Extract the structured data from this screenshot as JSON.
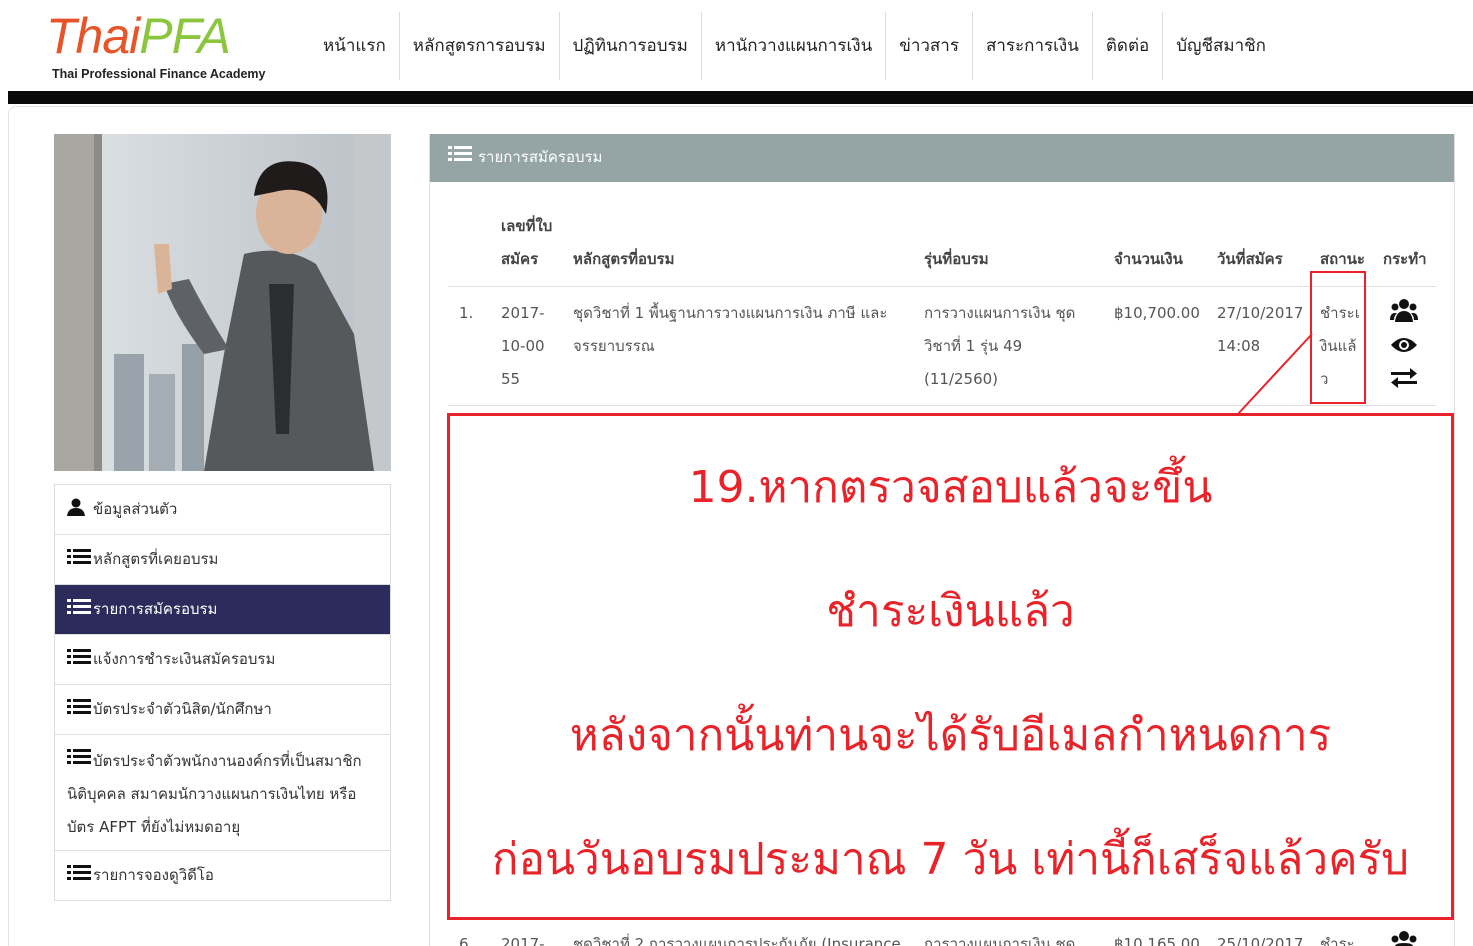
{
  "brand": {
    "name_part1": "Thai",
    "name_part2": "PFA",
    "tagline": "Thai Professional Finance Academy",
    "color_primary": "#e8542a",
    "color_secondary": "#8cc63f"
  },
  "nav": {
    "items": [
      {
        "label": "หน้าแรก"
      },
      {
        "label": "หลักสูตรการอบรม"
      },
      {
        "label": "ปฏิทินการอบรม"
      },
      {
        "label": "หานักวางแผนการเงิน"
      },
      {
        "label": "ข่าวสาร"
      },
      {
        "label": "สาระการเงิน"
      },
      {
        "label": "ติดต่อ"
      },
      {
        "label": "บัญชีสมาชิก"
      }
    ]
  },
  "sidebar": {
    "items": [
      {
        "icon": "user-icon",
        "label": "ข้อมูลส่วนตัว"
      },
      {
        "icon": "list-icon",
        "label": "หลักสูตรที่เคยอบรม"
      },
      {
        "icon": "list-icon",
        "label": "รายการสมัครอบรม",
        "active": true
      },
      {
        "icon": "list-icon",
        "label": "แจ้งการชำระเงินสมัครอบรม"
      },
      {
        "icon": "list-icon",
        "label": "บัตรประจำตัวนิสิต/นักศึกษา"
      },
      {
        "icon": "list-icon",
        "label": "บัตรประจำตัวพนักงานองค์กรที่เป็นสมาชิกนิติบุคคล สมาคมนักวางแผนการเงินไทย หรือบัตร AFPT ที่ยังไม่หมดอายุ"
      },
      {
        "icon": "list-icon",
        "label": "รายการจองดูวิดีโอ"
      }
    ]
  },
  "panel": {
    "title": "รายการสมัครอบรม",
    "columns": {
      "reg_no": "เลขที่ใบสมัคร",
      "course": "หลักสูตรที่อบรม",
      "batch": "รุ่นที่อบรม",
      "amount": "จำนวนเงิน",
      "date": "วันที่สมัคร",
      "status": "สถานะ",
      "action": "กระทำ"
    },
    "rows": [
      {
        "index": "1.",
        "reg_no": "2017-10-0055",
        "course": "ชุดวิชาที่ 1 พื้นฐานการวางแผนการเงิน ภาษี และจรรยาบรรณ",
        "batch": "การวางแผนการเงิน ชุดวิชาที่ 1 รุ่น 49 (11/2560)",
        "amount": "฿10,700.00",
        "date": "27/10/2017 14:08",
        "status": "ชำระเงินแล้ว"
      },
      {
        "index": "6.",
        "reg_no": "2017-",
        "course": "ชุดวิชาที่ 2 การวางแผนการประกันภัย (Insurance",
        "batch": "การวางแผนการเงิน ชุด",
        "amount": "฿10,165.00",
        "date": "25/10/2017",
        "status": "ชำระ"
      }
    ]
  },
  "annotation": {
    "line1": "19.หากตรวจสอบแล้วจะขึ้น",
    "line2": "ชำระเงินแล้ว",
    "line3": "หลังจากนั้นท่านจะได้รับอีเมลกำหนดการ",
    "line4": "ก่อนวันอบรมประมาณ 7 วัน เท่านี้ก็เสร็จแล้วครับ",
    "color": "#e8242a"
  }
}
